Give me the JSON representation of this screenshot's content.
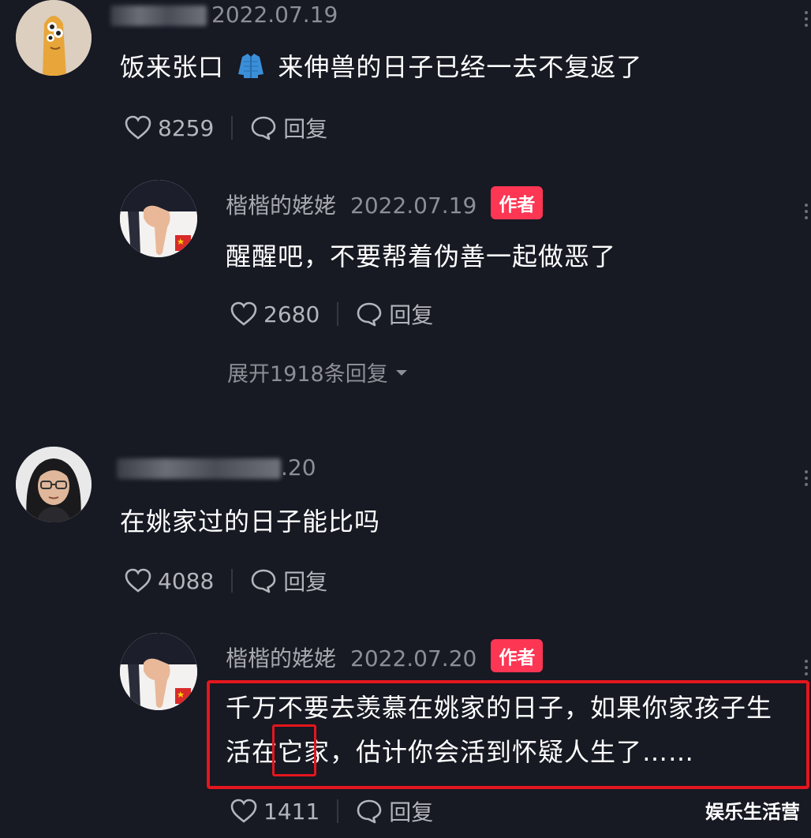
{
  "comments": [
    {
      "date": "2022.07.19",
      "text_before": "饭来张口",
      "emoji": "jacket-emoji",
      "text_after": "来伸兽的日子已经一去不复返了",
      "likes": "8259",
      "reply_label": "回复"
    },
    {
      "name": "楷楷的姥姥",
      "date": "2022.07.19",
      "badge": "作者",
      "text": "醒醒吧，不要帮着伪善一起做恶了",
      "likes": "2680",
      "reply_label": "回复",
      "expand_label": "展开1918条回复"
    },
    {
      "date_suffix": ".20",
      "text": "在姚家过的日子能比吗",
      "likes": "4088",
      "reply_label": "回复"
    },
    {
      "name": "楷楷的姥姥",
      "date": "2022.07.20",
      "badge": "作者",
      "text_line1": "千万不要去羡慕在姚家的日子，如果你家孩子生",
      "text_line2_a": "活在",
      "text_line2_highlight": "它",
      "text_line2_b": "家，估计你会活到怀疑人生了……",
      "likes": "1411",
      "reply_label": "回复"
    }
  ],
  "watermark": "娱乐生活营",
  "colors": {
    "background": "#171923",
    "author_badge": "#fd3654",
    "highlight": "#e4161d"
  }
}
